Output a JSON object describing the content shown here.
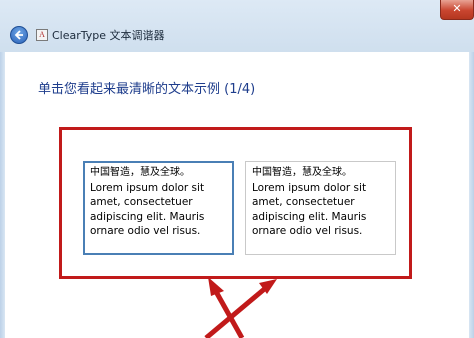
{
  "window": {
    "title": "ClearType 文本调谐器",
    "back_icon": "back-arrow-icon",
    "app_icon": "cleartype-app-icon",
    "app_icon_glyph": "A",
    "close_glyph": "✕"
  },
  "page": {
    "heading": "单击您看起来最清晰的文本示例 (1/4)"
  },
  "samples": [
    {
      "zh": "中国智造，慧及全球。",
      "lines": [
        "Lorem ipsum dolor sit",
        "amet, consectetuer",
        "adipiscing elit. Mauris",
        "ornare odio vel risus."
      ],
      "selected": true
    },
    {
      "zh": "中国智造，慧及全球。",
      "lines": [
        "Lorem ipsum dolor sit",
        "amet, consectetuer",
        "adipiscing elit. Mauris",
        "ornare odio vel risus."
      ],
      "selected": false
    }
  ],
  "colors": {
    "annotation_red": "#c11a1a",
    "heading_blue": "#1e3d8c",
    "selected_border": "#4a7fb5"
  }
}
